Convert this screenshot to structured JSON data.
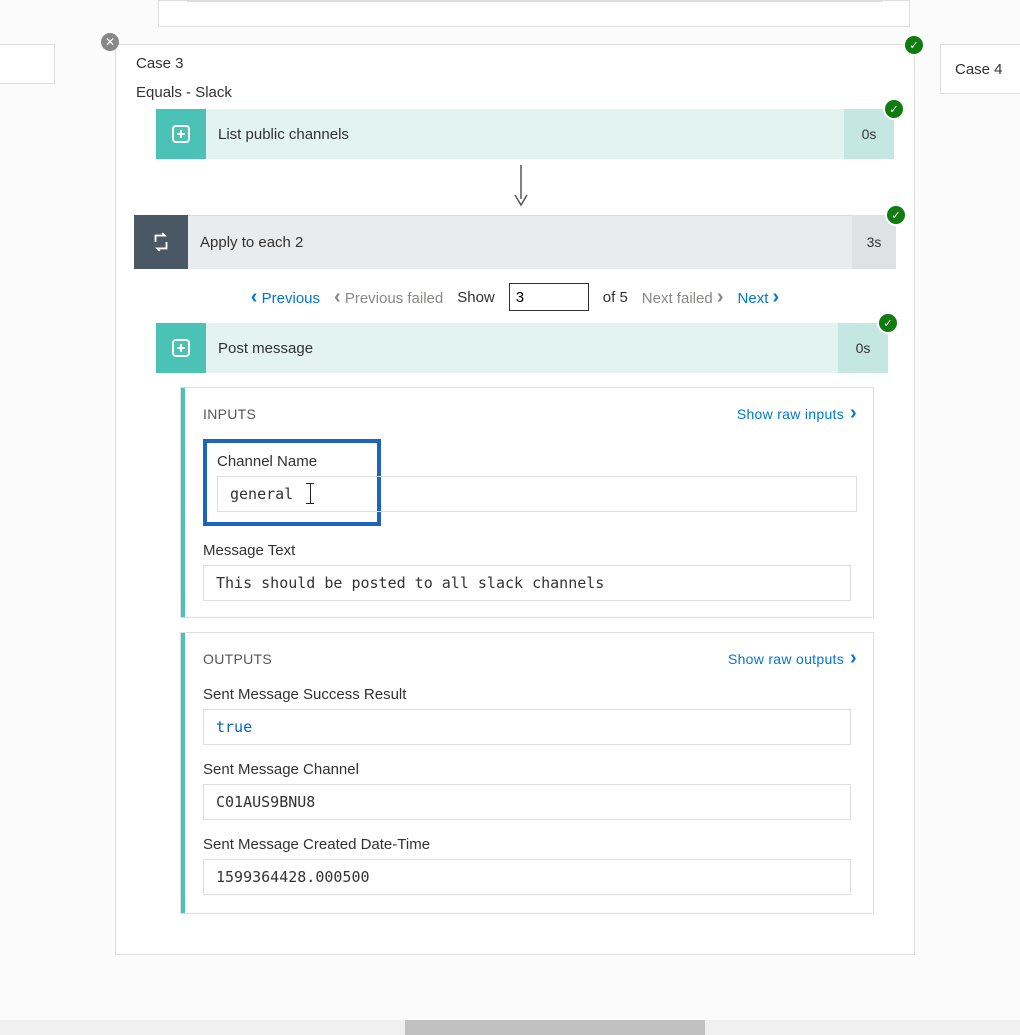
{
  "case3": {
    "title": "Case 3",
    "condition": "Equals - Slack"
  },
  "case4": {
    "title": "Case 4"
  },
  "listChannels": {
    "label": "List public channels",
    "duration": "0s"
  },
  "loop": {
    "label": "Apply to each 2",
    "duration": "3s"
  },
  "pager": {
    "previous": "Previous",
    "previous_failed": "Previous failed",
    "show_label": "Show",
    "current": "3",
    "of_label": "of 5",
    "next_failed": "Next failed",
    "next": "Next"
  },
  "postMessage": {
    "label": "Post message",
    "duration": "0s"
  },
  "inputs": {
    "title": "INPUTS",
    "raw": "Show raw inputs",
    "channel_name_label": "Channel Name",
    "channel_name_value": "general",
    "message_text_label": "Message Text",
    "message_text_value": "This should be posted to all slack channels"
  },
  "outputs": {
    "title": "OUTPUTS",
    "raw": "Show raw outputs",
    "success_label": "Sent Message Success Result",
    "success_value": "true",
    "channel_label": "Sent Message Channel",
    "channel_value": "C01AUS9BNU8",
    "created_label": "Sent Message Created Date-Time",
    "created_value": "1599364428.000500"
  }
}
